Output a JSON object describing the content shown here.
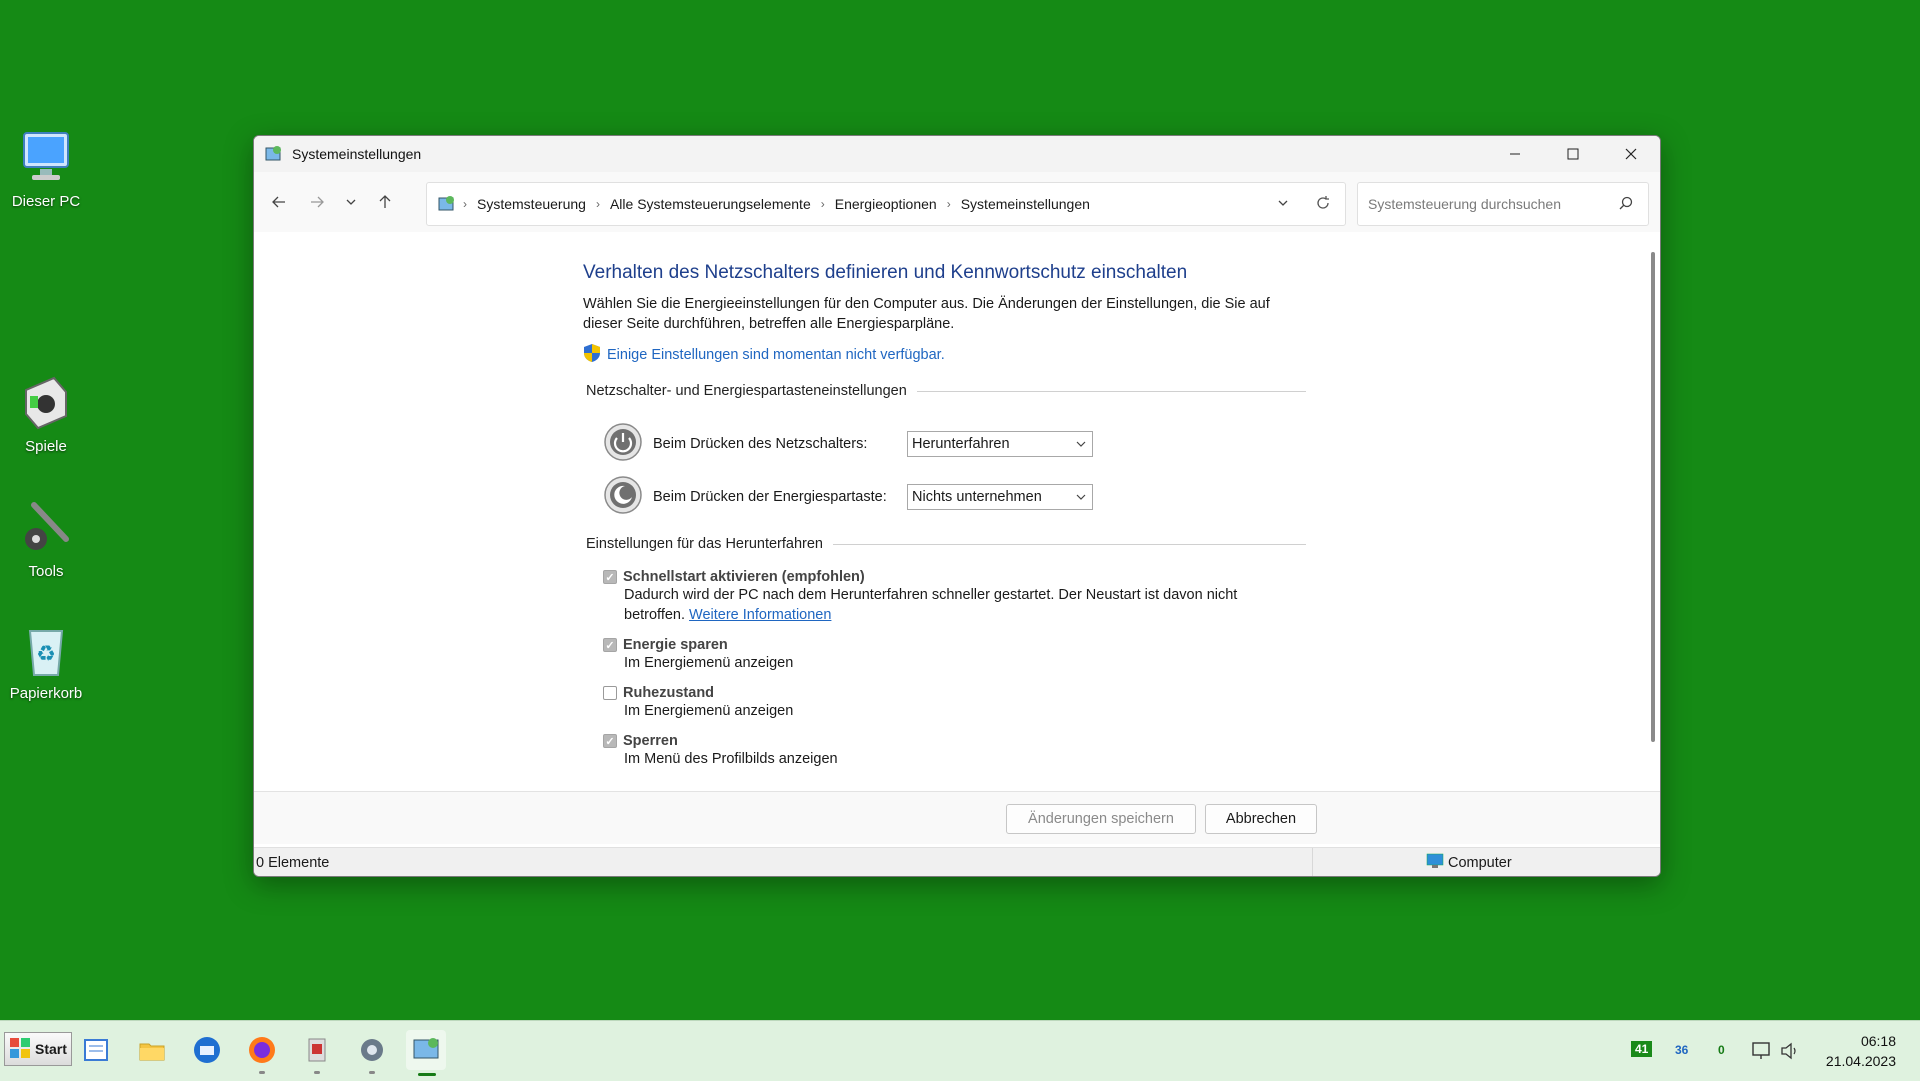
{
  "desktop": {
    "icons": [
      {
        "label": "Dieser PC",
        "icon": "computer-icon"
      },
      {
        "label": "Spiele",
        "icon": "games-icon"
      },
      {
        "label": "Tools",
        "icon": "tools-icon"
      },
      {
        "label": "Papierkorb",
        "icon": "recycle-bin-icon"
      }
    ]
  },
  "window": {
    "title": "Systemeinstellungen",
    "breadcrumb": [
      "Systemsteuerung",
      "Alle Systemsteuerungselemente",
      "Energieoptionen",
      "Systemeinstellungen"
    ],
    "search_placeholder": "Systemsteuerung durchsuchen"
  },
  "content": {
    "heading": "Verhalten des Netzschalters definieren und Kennwortschutz einschalten",
    "description": "Wählen Sie die Energieeinstellungen für den Computer aus. Die Änderungen der Einstellungen, die Sie auf dieser Seite durchführen, betreffen alle Energiesparpläne.",
    "unavailable_link": "Einige Einstellungen sind momentan nicht verfügbar.",
    "buttons_group_title": "Netzschalter- und Energiespartasteneinstellungen",
    "power_button_label": "Beim Drücken des Netzschalters:",
    "power_button_value": "Herunterfahren",
    "sleep_button_label": "Beim Drücken der Energiespartaste:",
    "sleep_button_value": "Nichts unternehmen",
    "shutdown_group_title": "Einstellungen für das Herunterfahren",
    "options": [
      {
        "title": "Schnellstart aktivieren (empfohlen)",
        "checked": true,
        "desc": "Dadurch wird der PC nach dem Herunterfahren schneller gestartet. Der Neustart ist davon nicht betroffen.",
        "link": "Weitere Informationen"
      },
      {
        "title": "Energie sparen",
        "checked": true,
        "desc": "Im Energiemenü anzeigen"
      },
      {
        "title": "Ruhezustand",
        "checked": false,
        "desc": "Im Energiemenü anzeigen"
      },
      {
        "title": "Sperren",
        "checked": true,
        "desc": "Im Menü des Profilbilds anzeigen"
      }
    ],
    "save_label": "Änderungen speichern",
    "cancel_label": "Abbrechen"
  },
  "statusbar": {
    "items_count": "0 Elemente",
    "location": "Computer"
  },
  "taskbar": {
    "start_label": "Start",
    "tray": {
      "cpu": "41",
      "temp": "36",
      "other": "0"
    },
    "time": "06:18",
    "date": "21.04.2023"
  }
}
